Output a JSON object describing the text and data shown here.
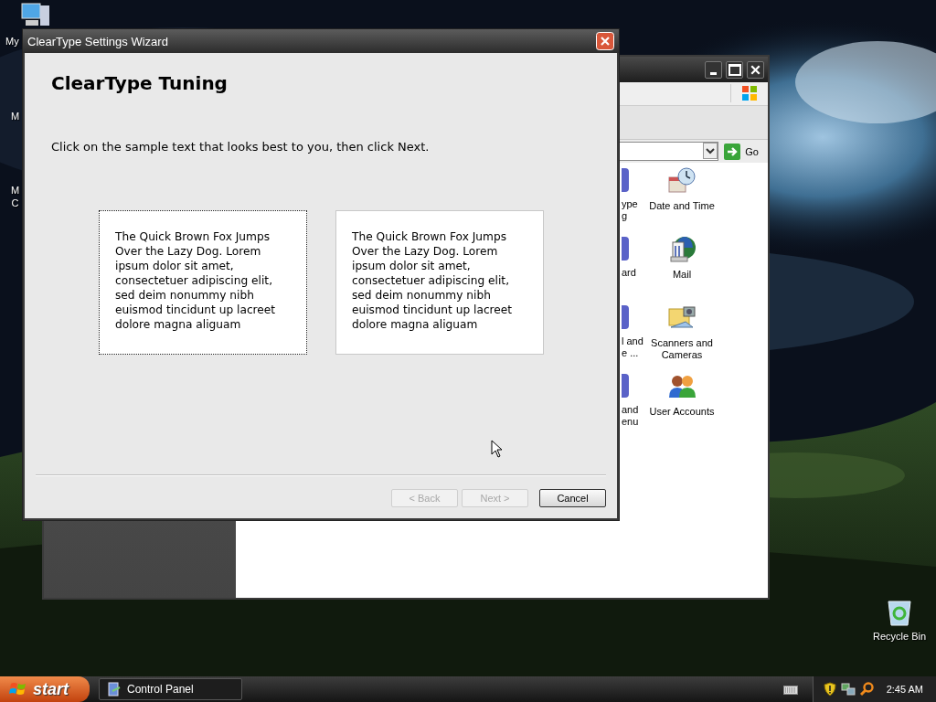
{
  "desktop": {
    "icons": [
      {
        "kind": "computer",
        "lines": [
          "My"
        ]
      },
      {
        "kind": "none",
        "lines": [
          "M"
        ]
      },
      {
        "kind": "none",
        "lines": [
          "M",
          "C"
        ]
      },
      {
        "kind": "recycle",
        "lines": [
          "Recycle Bin"
        ]
      }
    ]
  },
  "control_panel": {
    "go_label": "Go",
    "items": [
      {
        "partial_lines": [
          "ype",
          "g"
        ],
        "kind": "clock",
        "lines": [
          "Date and Time"
        ]
      },
      {
        "partial_lines": [
          "ard"
        ],
        "kind": "mail",
        "lines": [
          "Mail"
        ]
      },
      {
        "partial_lines": [
          "l and",
          "e ..."
        ],
        "kind": "scanner",
        "lines": [
          "Scanners and",
          "Cameras"
        ]
      },
      {
        "partial_lines": [
          "and",
          "enu"
        ],
        "kind": "users",
        "lines": [
          "User Accounts"
        ]
      }
    ]
  },
  "dialog": {
    "title": "ClearType Settings Wizard",
    "heading": "ClearType Tuning",
    "instruction": "Click on the sample text that looks best to you, then click Next.",
    "samples": [
      {
        "text": "The Quick Brown Fox Jumps Over the Lazy Dog. Lorem ipsum dolor sit amet, consectetuer adipiscing elit, sed deim nonummy nibh euismod tincidunt up lacreet dolore magna aliguam",
        "selected": true
      },
      {
        "text": "The Quick Brown Fox Jumps Over the Lazy Dog. Lorem ipsum dolor sit amet, consectetuer adipiscing elit, sed deim nonummy nibh euismod tincidunt up lacreet dolore magna aliguam",
        "selected": false
      }
    ],
    "buttons": [
      {
        "label": "< Back",
        "disabled": true
      },
      {
        "label": "Next >",
        "disabled": true
      },
      {
        "label": "Cancel",
        "disabled": false
      }
    ]
  },
  "taskbar": {
    "start_label": "start",
    "tasks": [
      {
        "label": "Control Panel"
      }
    ],
    "clock": "2:45 AM"
  }
}
